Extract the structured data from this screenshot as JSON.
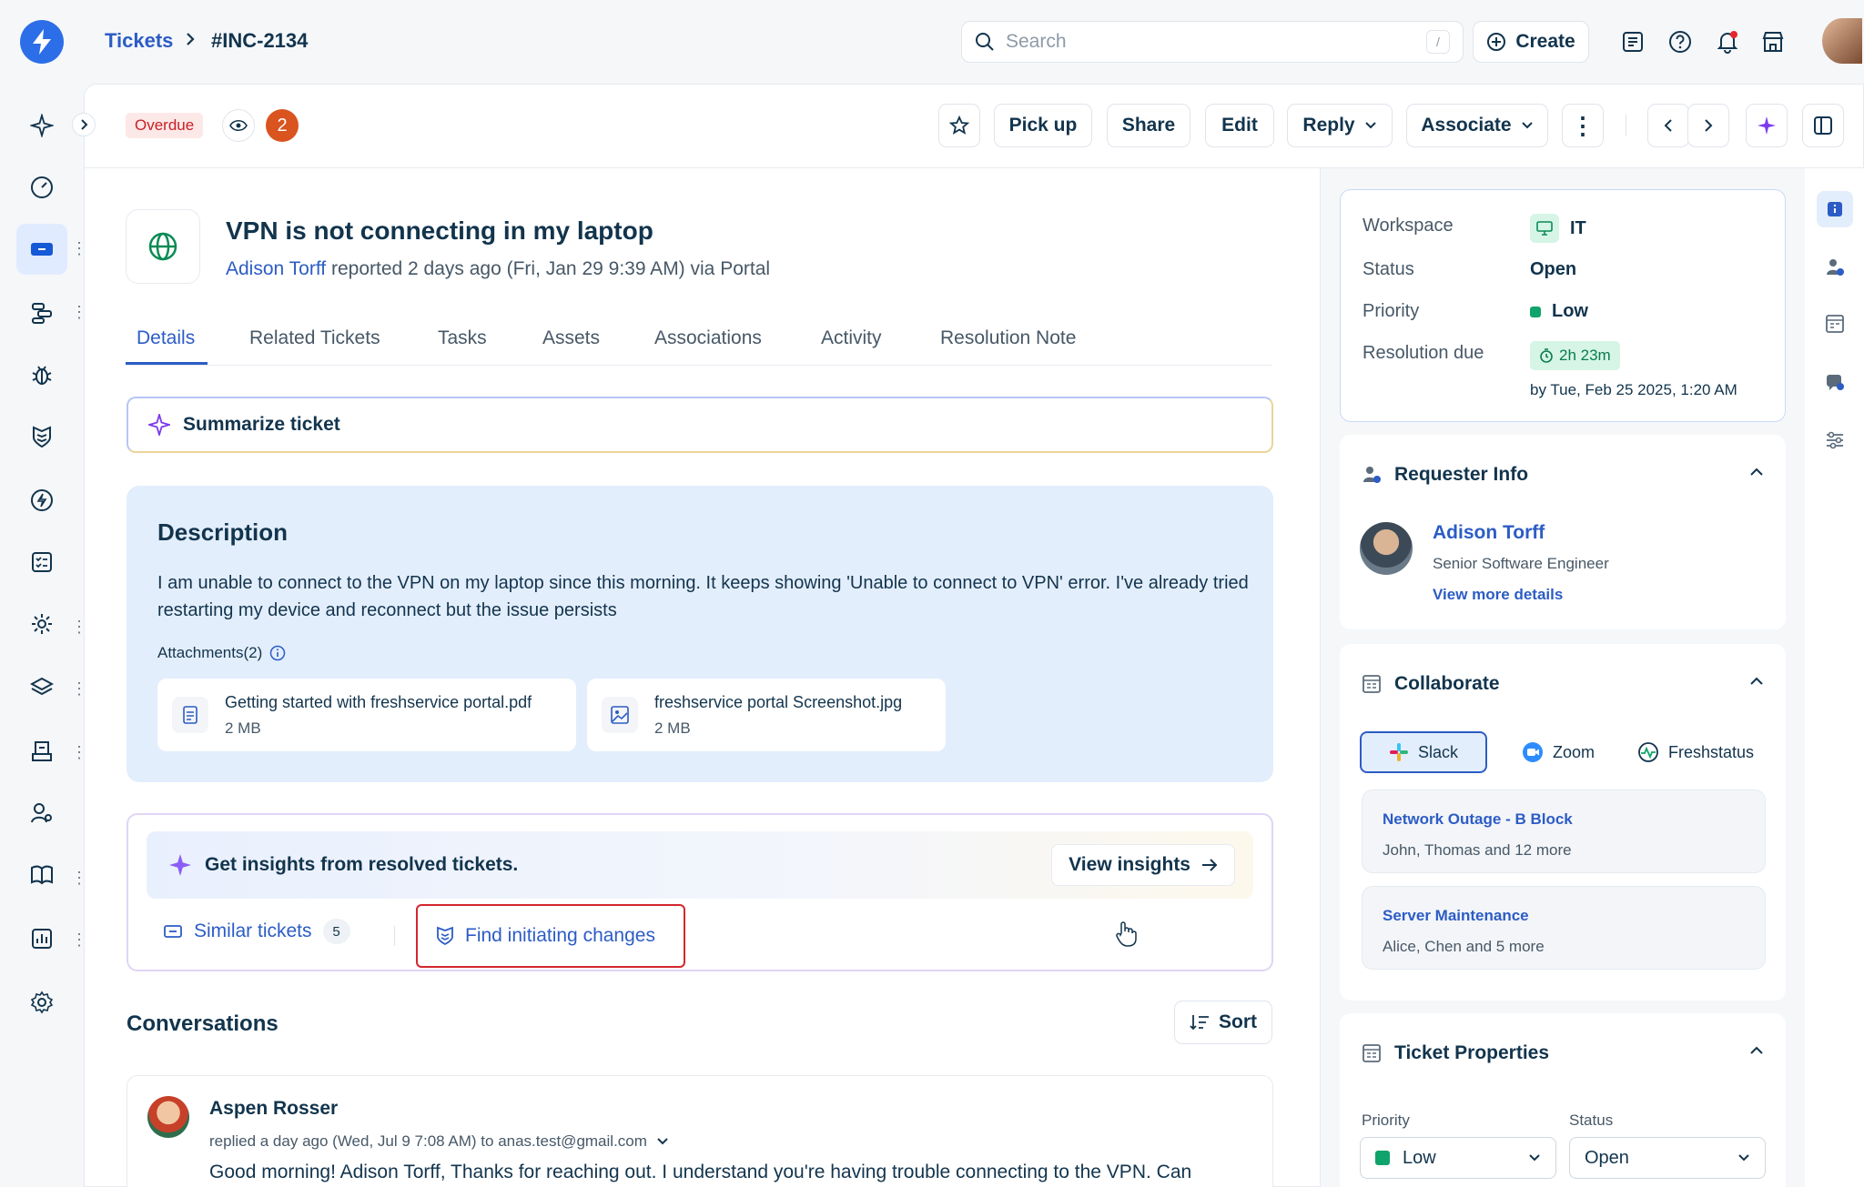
{
  "breadcrumb": {
    "root": "Tickets",
    "ticket_id": "#INC-2134"
  },
  "search": {
    "placeholder": "Search",
    "shortcut": "/"
  },
  "topbar": {
    "create_label": "Create"
  },
  "header": {
    "overdue_label": "Overdue",
    "watch_count": "2",
    "buttons": {
      "pickup": "Pick up",
      "share": "Share",
      "edit": "Edit",
      "reply": "Reply",
      "associate": "Associate"
    }
  },
  "ticket": {
    "title": "VPN is not connecting in my laptop",
    "requester": "Adison Torff",
    "reported_text": " reported 2 days ago (Fri, Jan 29 9:39 AM) via Portal"
  },
  "tabs": [
    "Details",
    "Related Tickets",
    "Tasks",
    "Assets",
    "Associations",
    "Activity",
    "Resolution Note"
  ],
  "summarize_label": "Summarize ticket",
  "description": {
    "heading": "Description",
    "body": "I am unable to connect to the VPN on my laptop since this morning. It keeps showing 'Unable to connect to VPN' error. I've already tried restarting my device and reconnect but the issue persists",
    "attachments_label": "Attachments(2)",
    "attachments": [
      {
        "name": "Getting started with freshservice portal.pdf",
        "size": "2 MB",
        "icon": "document-icon"
      },
      {
        "name": "freshservice portal Screenshot.jpg",
        "size": "2 MB",
        "icon": "image-icon"
      }
    ]
  },
  "insights": {
    "text": "Get insights from resolved tickets.",
    "view_label": "View insights",
    "similar_label": "Similar tickets",
    "similar_count": "5",
    "find_changes_label": "Find initiating changes"
  },
  "conversations": {
    "heading": "Conversations",
    "sort_label": "Sort",
    "items": [
      {
        "author": "Aspen Rosser",
        "meta": "replied a day ago (Wed, Jul 9 7:08 AM) to anas.test@gmail.com",
        "body": "Good morning! Adison Torff, Thanks for reaching out. I understand you're having trouble connecting to the VPN. Can"
      }
    ]
  },
  "info": {
    "workspace_label": "Workspace",
    "workspace_value": "IT",
    "status_label": "Status",
    "status_value": "Open",
    "priority_label": "Priority",
    "priority_value": "Low",
    "resolution_label": "Resolution due",
    "sla_value": "2h 23m",
    "due_text": "by Tue, Feb 25 2025, 1:20 AM"
  },
  "requester_info": {
    "heading": "Requester Info",
    "name": "Adison Torff",
    "title": "Senior Software Engineer",
    "link": "View more details"
  },
  "collaborate": {
    "heading": "Collaborate",
    "tools": [
      "Slack",
      "Zoom",
      "Freshstatus"
    ],
    "channels": [
      {
        "name": "Network Outage - B Block",
        "members": "John, Thomas and 12 more"
      },
      {
        "name": "Server Maintenance",
        "members": "Alice, Chen and 5 more"
      }
    ]
  },
  "properties": {
    "heading": "Ticket Properties",
    "priority_label": "Priority",
    "priority_value": "Low",
    "status_label": "Status",
    "status_value": "Open"
  },
  "colors": {
    "accent": "#2c5cc5",
    "overdue": "#c82124",
    "badge": "#d9541e",
    "low": "#10a36b",
    "highlight": "#d4262d"
  }
}
